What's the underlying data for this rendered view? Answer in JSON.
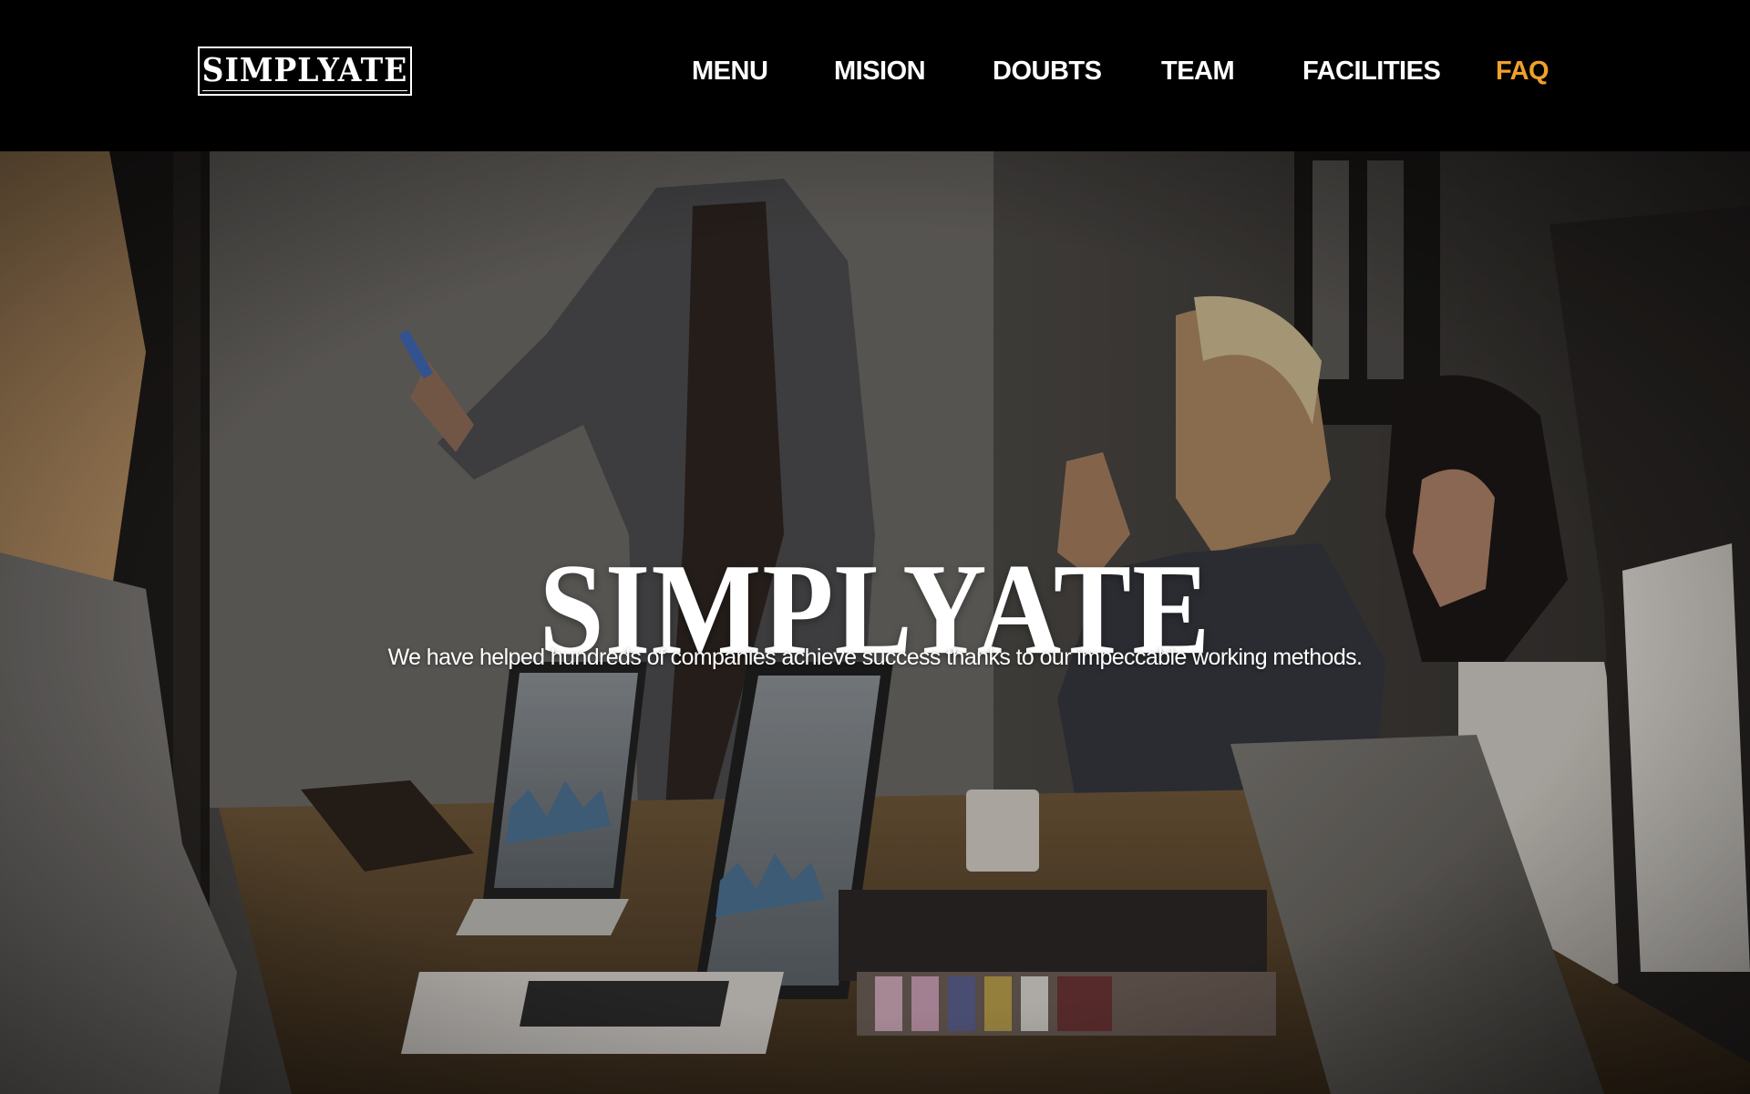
{
  "brand": {
    "logo_text": "SIMPLYATE"
  },
  "nav": {
    "items": [
      {
        "label": "MENU"
      },
      {
        "label": "MISION"
      },
      {
        "label": "DOUBTS"
      },
      {
        "label": "TEAM"
      },
      {
        "label": "FACILITIES"
      },
      {
        "label": "FAQ",
        "active": true
      }
    ],
    "active_color": "#f0a12b"
  },
  "hero": {
    "title": "SIMPLYATE",
    "subtitle": "We have helped hundreds of companies achieve success thanks to our impeccable working methods."
  }
}
